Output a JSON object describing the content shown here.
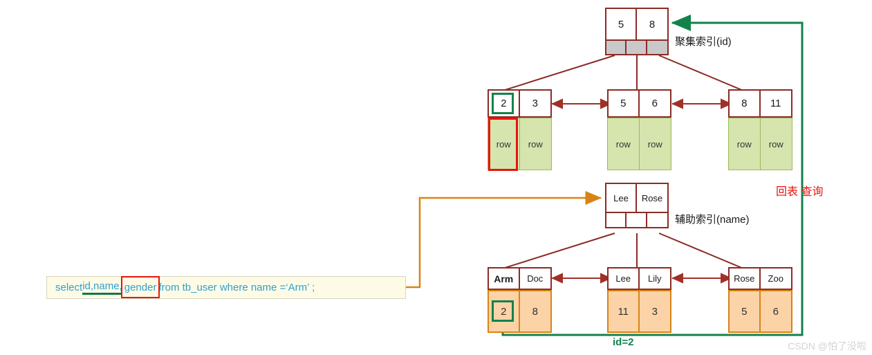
{
  "diagram": {
    "title_clustered": "聚集索引(id)",
    "title_secondary": "辅助索引(name)",
    "lookup_label": "回表 查询",
    "id_label": "id=2",
    "watermark": "CSDN @怕了没啦"
  },
  "sql": {
    "part1": "select ",
    "underlined": "id,name,",
    "boxed": "gender",
    "part2": " from  tb_user  where  name =",
    "value": "‘Arm’ ;"
  },
  "clustered_index": {
    "root": {
      "keys": [
        "5",
        "8"
      ],
      "pointers": [
        "",
        "",
        ""
      ]
    },
    "leaves": [
      {
        "keys": [
          "2",
          "3"
        ],
        "data": [
          "row",
          "row"
        ]
      },
      {
        "keys": [
          "5",
          "6"
        ],
        "data": [
          "row",
          "row"
        ]
      },
      {
        "keys": [
          "8",
          "11"
        ],
        "data": [
          "row",
          "row"
        ]
      }
    ]
  },
  "secondary_index": {
    "root": {
      "keys": [
        "Lee",
        "Rose"
      ],
      "pointers": [
        "",
        "",
        ""
      ]
    },
    "leaves": [
      {
        "keys": [
          "Arm",
          "Doc"
        ],
        "data": [
          "2",
          "8"
        ]
      },
      {
        "keys": [
          "Lee",
          "Lily"
        ],
        "data": [
          "11",
          "3"
        ]
      },
      {
        "keys": [
          "Rose",
          "Zoo"
        ],
        "data": [
          "5",
          "6"
        ]
      }
    ]
  },
  "colors": {
    "node_border": "#8c2b26",
    "green_path": "#12824c",
    "orange_path": "#d98316",
    "red_highlight": "#e8140e",
    "clustered_data_fill": "#d6e4ae",
    "secondary_data_fill": "#fbd3a6"
  }
}
